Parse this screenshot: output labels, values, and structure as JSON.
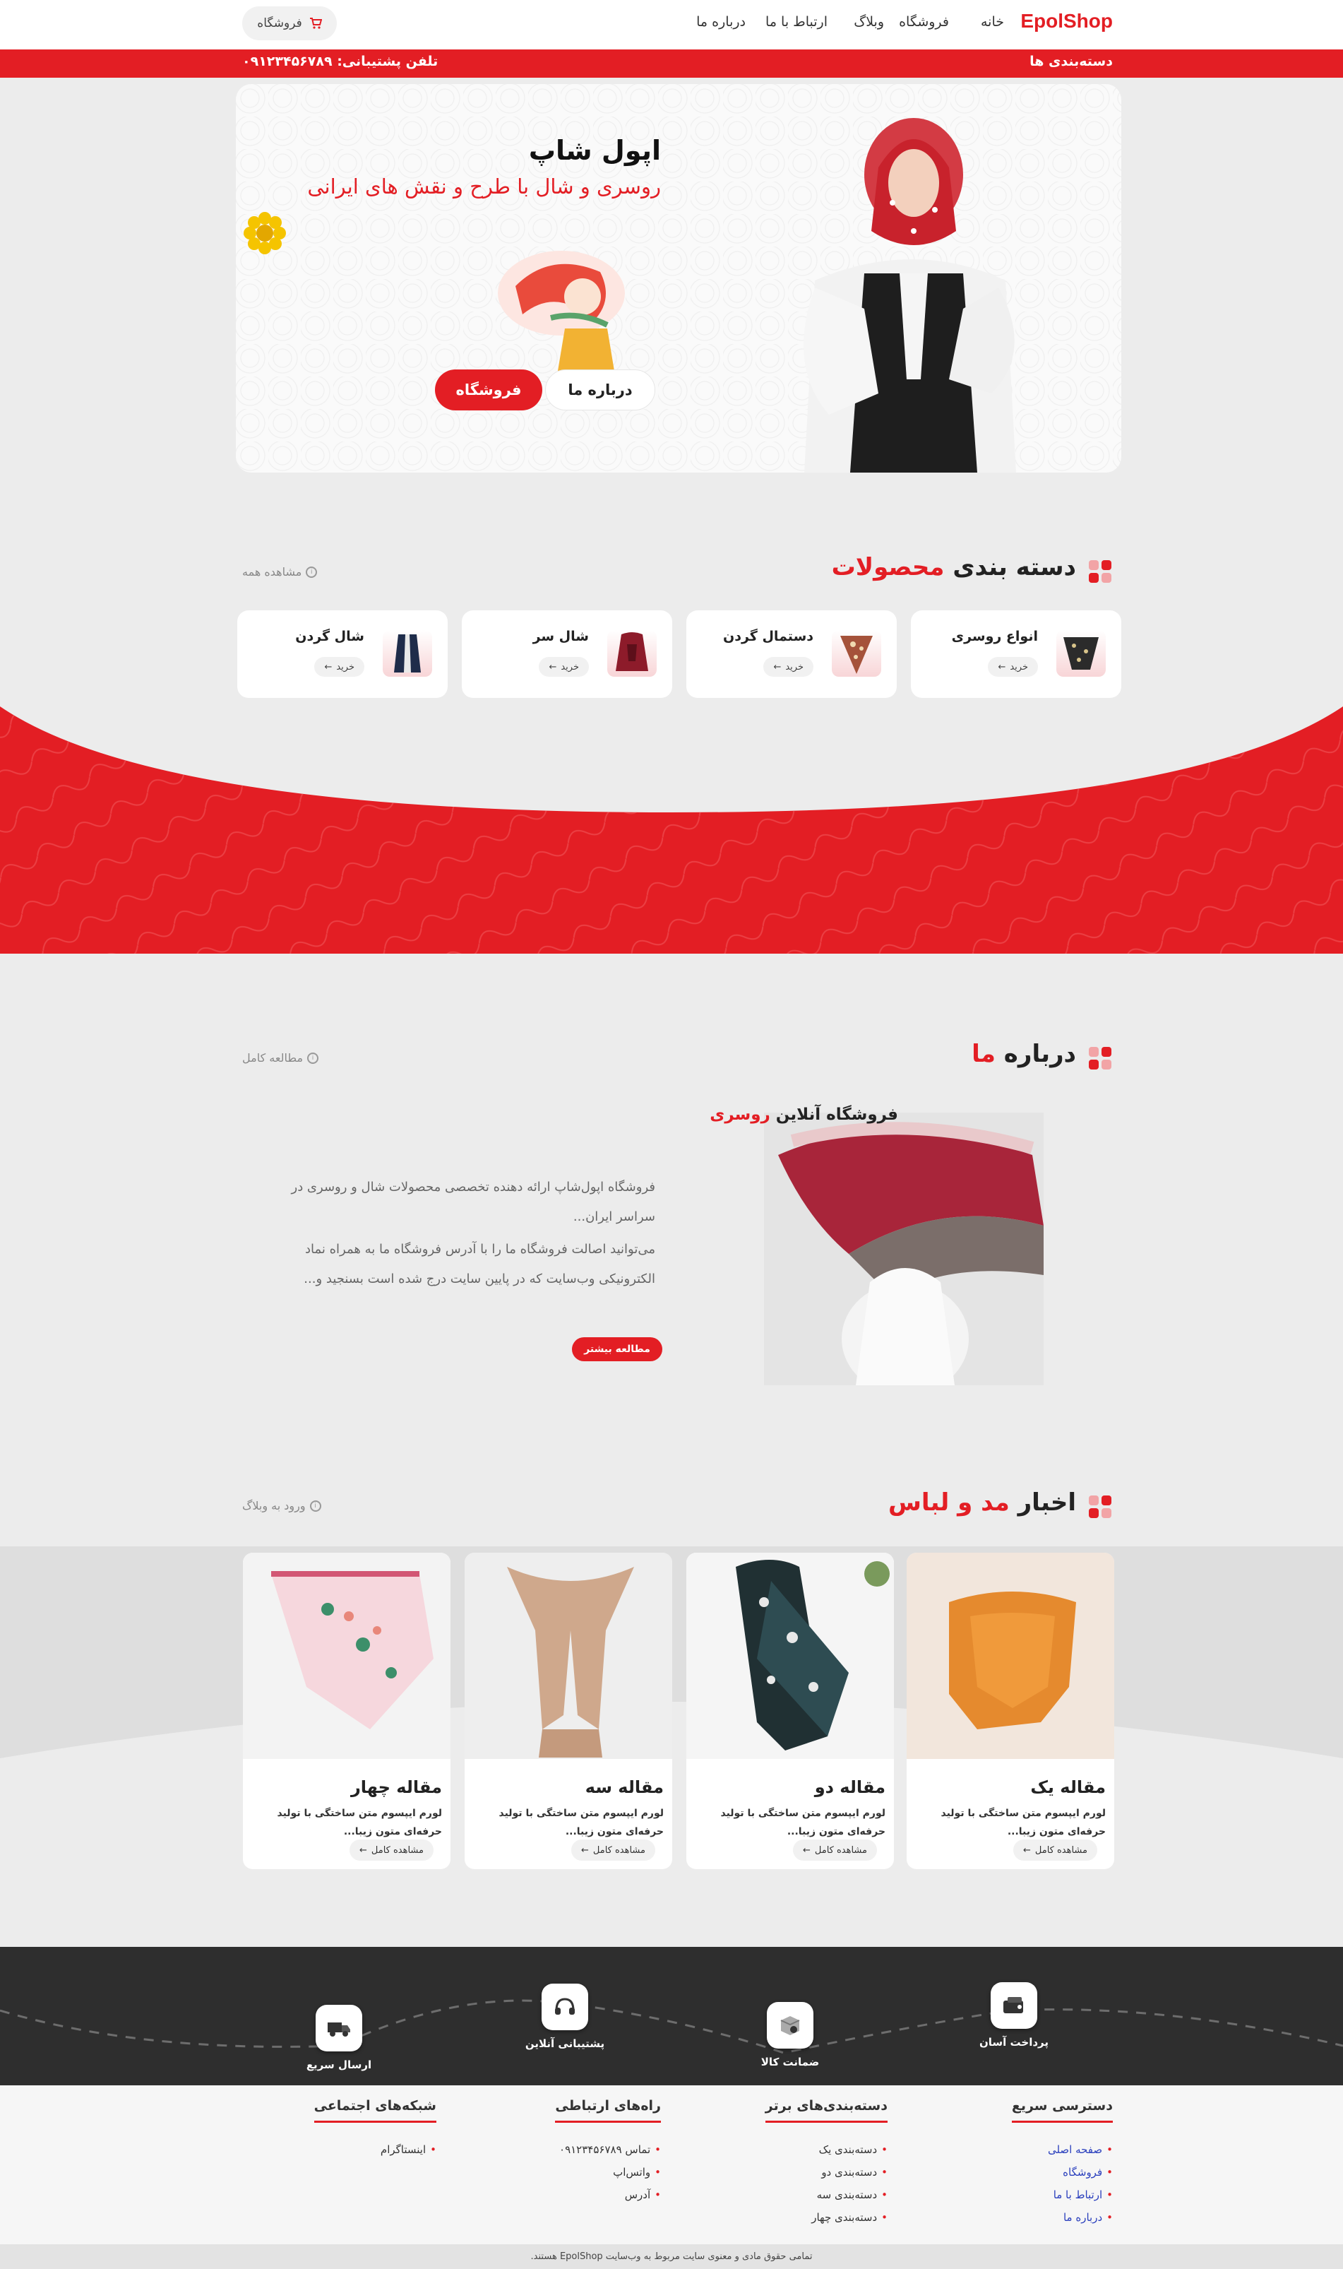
{
  "brand": {
    "name": "EpolShop",
    "accent": "#e31e24"
  },
  "nav": {
    "items": [
      "خانه",
      "فروشگاه",
      "وبلاگ",
      "ارتباط با ما",
      "درباره ما"
    ],
    "cart_label": "فروشگاه"
  },
  "topbar": {
    "categories_label": "دسته‌بندی ها",
    "phone_label": "تلفن پشتیبانی:",
    "phone": "۰۹۱۲۳۴۵۶۷۸۹"
  },
  "hero": {
    "title": "اپول شاپ",
    "subtitle": "روسری و شال با طرح و نقش های ایرانی",
    "shop_button": "فروشگاه",
    "about_button": "درباره ما"
  },
  "categories": {
    "title_a": "دسته بندی",
    "title_b": "محصولات",
    "view_all": "مشاهده همه",
    "buy_label": "خرید",
    "items": [
      {
        "name": "انواع روسری"
      },
      {
        "name": "دستمال گردن"
      },
      {
        "name": "شال سر"
      },
      {
        "name": "شال گردن"
      }
    ]
  },
  "about": {
    "title_a": "درباره",
    "title_b": "ما",
    "read_full": "مطالعه کامل",
    "heading_a": "فروشگاه آنلاین",
    "heading_b": "روسری",
    "p1": "فروشگاه اپول‌شاپ ارائه دهنده تخصصی محصولات شال و روسری در سراسر ایران...",
    "p2": "می‌توانید اصالت فروشگاه ما را با آدرس فروشگاه ما به همراه نماد الکترونیکی وب‌سایت که در پایین سایت درج شده است بسنجید و...",
    "more_button": "مطالعه بیشتر"
  },
  "blog": {
    "title_a": "اخبار",
    "title_b": "مد و لباس",
    "enter_blog": "ورود به وبلاگ",
    "more_label": "مشاهده کامل",
    "excerpt": "لورم ایپسوم متن ساختگی با تولید حرفه‌ای متون زیبا...",
    "posts": [
      {
        "title": "مقاله یک"
      },
      {
        "title": "مقاله دو"
      },
      {
        "title": "مقاله سه"
      },
      {
        "title": "مقاله چهار"
      }
    ]
  },
  "features": [
    {
      "label": "پرداخت آسان",
      "icon": "wallet-icon"
    },
    {
      "label": "ضمانت کالا",
      "icon": "package-icon"
    },
    {
      "label": "پشتیبانی آنلاین",
      "icon": "headset-icon"
    },
    {
      "label": "ارسال سریع",
      "icon": "truck-icon"
    }
  ],
  "footer": {
    "quick": {
      "title": "دسترسی سریع",
      "items": [
        "صفحه اصلی",
        "فروشگاه",
        "ارتباط با ما",
        "درباره ما"
      ]
    },
    "top_cats": {
      "title": "دسته‌بندی‌های برتر",
      "items": [
        "دسته‌بندی یک",
        "دسته‌بندی دو",
        "دسته‌بندی سه",
        "دسته‌بندی چهار"
      ]
    },
    "contact": {
      "title": "راه‌های ارتباطی",
      "items": [
        "تماس ۰۹۱۲۳۴۵۶۷۸۹",
        "واتس‌اپ",
        "آدرس"
      ]
    },
    "social": {
      "title": "شبکه‌های اجتماعی",
      "items": [
        "اینستاگرام"
      ]
    },
    "copyright": "تمامی حقوق مادی و معنوی سایت مربوط به وب‌سایت EpolShop هستند."
  }
}
